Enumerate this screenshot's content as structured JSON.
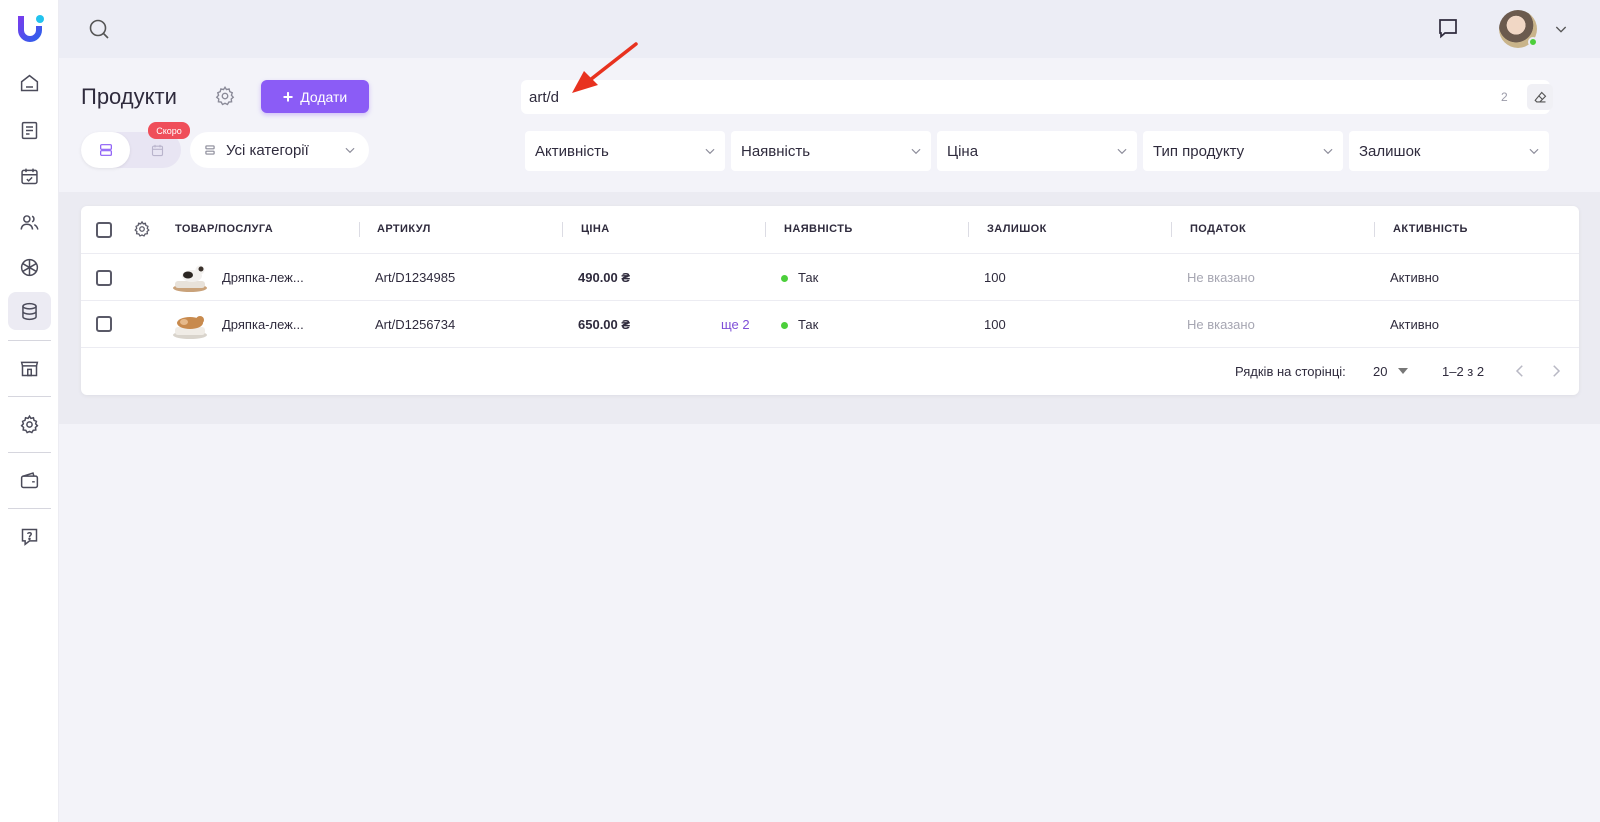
{
  "app": {
    "logo": "U"
  },
  "sidebar": {
    "items": [
      {
        "icon": "home-icon"
      },
      {
        "icon": "receipt-icon"
      },
      {
        "icon": "calendar-check-icon"
      },
      {
        "icon": "users-icon"
      },
      {
        "icon": "cube-icon"
      },
      {
        "icon": "database-icon",
        "active": true
      },
      {
        "icon": "store-icon"
      },
      {
        "icon": "gear-icon"
      },
      {
        "icon": "wallet-icon"
      },
      {
        "icon": "help-icon"
      }
    ]
  },
  "header": {
    "title": "Продукти",
    "add_label": "Додати",
    "soon_badge": "Скоро",
    "category_select": "Усі категорії"
  },
  "search": {
    "value": "art/d",
    "count": "2"
  },
  "filters": [
    "Активність",
    "Наявність",
    "Ціна",
    "Тип продукту",
    "Залишок"
  ],
  "table": {
    "columns": [
      "ТОВАР/ПОСЛУГА",
      "АРТИКУЛ",
      "ЦІНА",
      "НАЯВНІСТЬ",
      "ЗАЛИШОК",
      "ПОДАТОК",
      "АКТИВНІСТЬ"
    ],
    "rows": [
      {
        "name": "Дряпка-леж...",
        "sku": "Art/D1234985",
        "price": "490.00 ₴",
        "more": "",
        "availability": "Так",
        "stock": "100",
        "tax": "Не вказано",
        "activity": "Активно"
      },
      {
        "name": "Дряпка-леж...",
        "sku": "Art/D1256734",
        "price": "650.00 ₴",
        "more": "ще 2",
        "availability": "Так",
        "stock": "100",
        "tax": "Не вказано",
        "activity": "Активно"
      }
    ]
  },
  "pagination": {
    "rows_label": "Рядків на сторінці:",
    "rows_value": "20",
    "range": "1–2 з 2"
  },
  "colors": {
    "accent": "#8b5cf6",
    "success": "#4ccf3b",
    "badge": "#ef4e5a"
  }
}
